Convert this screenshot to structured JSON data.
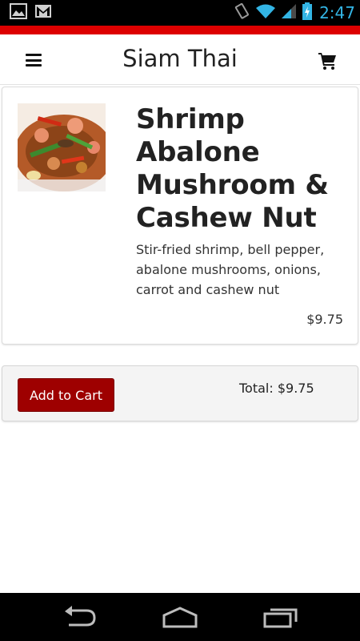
{
  "status_bar": {
    "time": "2:47",
    "icons": [
      "gallery-icon",
      "gmail-icon",
      "vibrate-icon",
      "wifi-icon",
      "signal-icon",
      "battery-charging-icon"
    ]
  },
  "colors": {
    "accent_red": "#dd0000",
    "button_red": "#9e0000",
    "status_blue": "#33b5e5"
  },
  "header": {
    "title": "Siam Thai",
    "menu_icon": "menu-icon",
    "cart_icon": "cart-icon"
  },
  "item": {
    "name": "Shrimp Abalone Mushroom & Cashew Nut",
    "description": "Stir-fried shrimp, bell pepper, abalone mushrooms, onions, carrot and cashew nut",
    "price": "$9.75"
  },
  "cart": {
    "add_label": "Add to Cart",
    "total": "Total: $9.75"
  },
  "nav_bar": {
    "icons": [
      "back-icon",
      "home-icon",
      "recent-apps-icon"
    ]
  }
}
